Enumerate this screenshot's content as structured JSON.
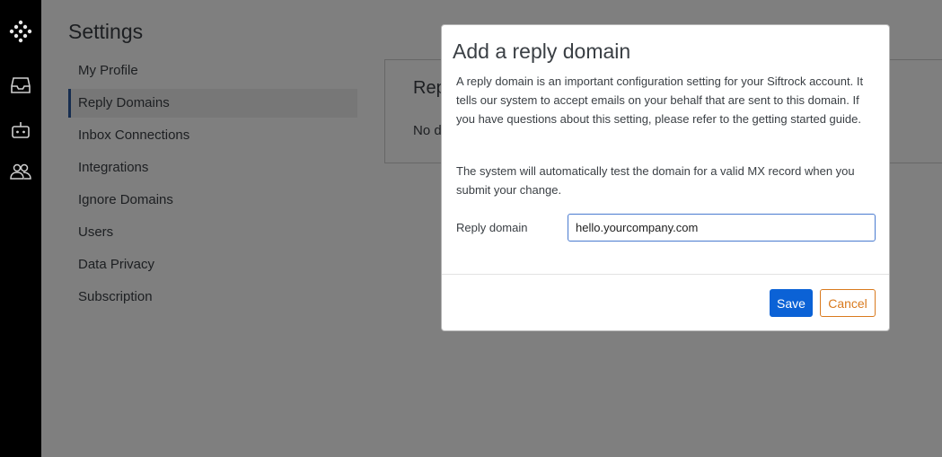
{
  "settings": {
    "title": "Settings",
    "nav": [
      "My Profile",
      "Reply Domains",
      "Inbox Connections",
      "Integrations",
      "Ignore Domains",
      "Users",
      "Data Privacy",
      "Subscription"
    ]
  },
  "card": {
    "title": "Rep",
    "body": "No d"
  },
  "modal": {
    "title": "Add a reply domain",
    "paragraph1": "A reply domain is an important configuration setting for your Siftrock account. It tells our system to accept emails on your behalf that are sent to this domain. If you have questions about this setting, please refer to the getting started guide.",
    "paragraph2": "The system will automatically test the domain for a valid MX record when you submit your change.",
    "field_label": "Reply domain",
    "field_value": "hello.yourcompany.com",
    "save_label": "Save",
    "cancel_label": "Cancel"
  },
  "rail_icons": [
    "app-logo-icon",
    "inbox-icon",
    "robot-icon",
    "users-icon"
  ],
  "colors": {
    "accent": "#0b62d6",
    "cancel": "#d97a1e",
    "active_nav_border": "#2d5aa0"
  }
}
